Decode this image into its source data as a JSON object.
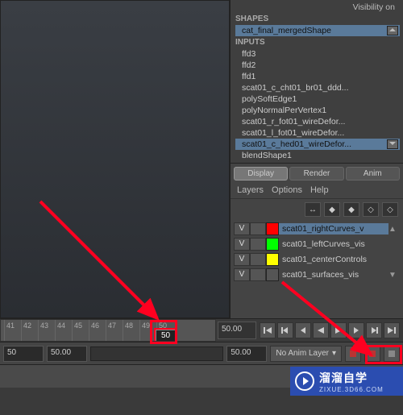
{
  "attributes": {
    "visibility_label": "Visibility on",
    "shapes_header": "SHAPES",
    "shapes": [
      "cat_final_mergedShape"
    ],
    "inputs_header": "INPUTS",
    "inputs": [
      "ffd3",
      "ffd2",
      "ffd1",
      "scat01_c_cht01_br01_ddd...",
      "polySoftEdge1",
      "polyNormalPerVertex1",
      "scat01_r_fot01_wireDefor...",
      "scat01_l_fot01_wireDefor...",
      "scat01_c_hed01_wireDefor...",
      "blendShape1"
    ]
  },
  "display_tabs": {
    "display": "Display",
    "render": "Render",
    "anim": "Anim"
  },
  "layer_menu": {
    "layers": "Layers",
    "options": "Options",
    "help": "Help"
  },
  "layers": [
    {
      "v": "V",
      "color": "#ff0000",
      "name": "scat01_rightCurves_v",
      "selected": true
    },
    {
      "v": "V",
      "color": "#00ff00",
      "name": "scat01_leftCurves_vis",
      "selected": false
    },
    {
      "v": "V",
      "color": "#ffff00",
      "name": "scat01_centerControls",
      "selected": false
    },
    {
      "v": "V",
      "color": "",
      "name": "scat01_surfaces_vis",
      "selected": false
    }
  ],
  "timeline": {
    "ticks": [
      "41",
      "42",
      "43",
      "44",
      "45",
      "46",
      "47",
      "48",
      "49",
      "50"
    ],
    "current_frame": "50",
    "end": "50.00"
  },
  "range": {
    "start_outer": "50",
    "start_inner": "50.00",
    "end_inner": "50.00",
    "anim_layer": "No Anim Layer"
  },
  "watermark": {
    "title": "溜溜自学",
    "sub": "ZIXUE.3D66.COM"
  }
}
